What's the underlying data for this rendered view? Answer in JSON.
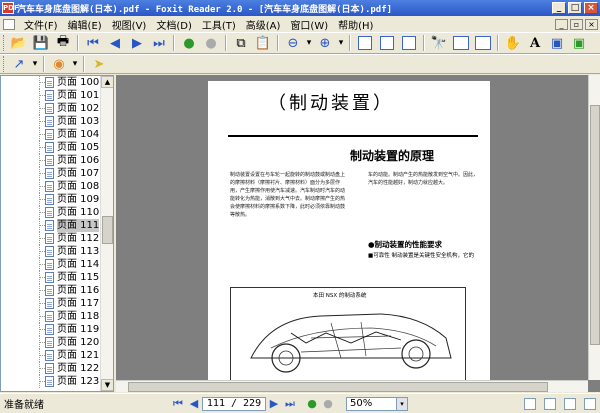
{
  "window": {
    "title": "汽车车身底盘图解(日本).pdf - Foxit Reader 2.0 - [汽车车身底盘图解(日本).pdf]",
    "app_icon_text": "PDF",
    "controls": {
      "minimize": "_",
      "maximize": "□",
      "close": "×"
    }
  },
  "menu": {
    "items": [
      "文件(F)",
      "编辑(E)",
      "视图(V)",
      "文档(D)",
      "工具(T)",
      "高级(A)",
      "窗口(W)",
      "帮助(H)"
    ],
    "mdi_controls": {
      "minimize": "_",
      "restore": "▫",
      "close": "×"
    }
  },
  "toolbar1": {
    "icons": [
      "open-icon",
      "save-icon",
      "print-icon",
      "first-page-icon",
      "previous-page-icon",
      "next-page-icon",
      "last-page-icon",
      "back-icon",
      "forward-icon",
      "copy-icon",
      "paste-icon",
      "zoom-out-icon",
      "zoom-in-icon",
      "actual-size-icon",
      "fit-page-icon",
      "fit-width-icon",
      "find-icon",
      "continuous-icon",
      "two-page-icon",
      "hand-tool-icon",
      "text-select-icon",
      "snapshot-icon",
      "image-tool-icon"
    ],
    "glyphs": {
      "open": "📂",
      "save": "💾",
      "print": "🖶",
      "first": "⏮",
      "prev": "◀",
      "next": "▶",
      "last": "⏭",
      "back": "●",
      "forward": "●",
      "copy": "⧉",
      "paste": "📋",
      "zoom_out": "⊖",
      "zoom_in": "⊕",
      "dropdown": "▾",
      "find": "🔭",
      "hand": "✋",
      "text": "A",
      "image": "▣"
    }
  },
  "toolbar2": {
    "glyphs": {
      "link": "↗",
      "dropdown": "▾",
      "annotation": "◉",
      "select": "➤"
    }
  },
  "sidebar": {
    "pages": [
      {
        "label": "页面 100"
      },
      {
        "label": "页面 101"
      },
      {
        "label": "页面 102"
      },
      {
        "label": "页面 103"
      },
      {
        "label": "页面 104"
      },
      {
        "label": "页面 105"
      },
      {
        "label": "页面 106"
      },
      {
        "label": "页面 107"
      },
      {
        "label": "页面 108"
      },
      {
        "label": "页面 109"
      },
      {
        "label": "页面 110"
      },
      {
        "label": "页面 111",
        "selected": true
      },
      {
        "label": "页面 112"
      },
      {
        "label": "页面 113"
      },
      {
        "label": "页面 114"
      },
      {
        "label": "页面 115"
      },
      {
        "label": "页面 116"
      },
      {
        "label": "页面 117"
      },
      {
        "label": "页面 118"
      },
      {
        "label": "页面 119"
      },
      {
        "label": "页面 120"
      },
      {
        "label": "页面 121"
      },
      {
        "label": "页面 122"
      },
      {
        "label": "页面 123"
      }
    ],
    "scroll_up": "▲",
    "scroll_down": "▼"
  },
  "document": {
    "title": "（制动装置）",
    "heading": "制动装置的原理",
    "col1_text": "制动装置设置在与车轮一起旋转的制动鼓或制动盘上的摩擦材料（摩擦衬片、摩擦材料）面分为多层作用，产生摩擦作用使汽车减速。汽车制动时汽车的动能转化为热能，消散到大气中去。制动摩擦产生的热会使摩擦材料的摩擦系数下降，此时必须依靠制动鼓等散热。",
    "col2_text": "车的动能。制动产生的热能散发到空气中。因此，汽车的性能越好，制动力就应越大。",
    "sub_heading": "●制动装置的性能要求",
    "sub_text": "■可靠性 制动装置是关键性安全机构，它的",
    "figure_caption": "本田 NSX 的制动系统"
  },
  "statusbar": {
    "status": "准备就绪",
    "page_display": "111 / 229",
    "zoom": "50%",
    "glyphs": {
      "first": "⏮",
      "prev": "◀",
      "next": "▶",
      "last": "⏭",
      "back": "●",
      "forward": "●",
      "dropdown": "▾"
    }
  },
  "colors": {
    "titlebar": "#2a57c8",
    "chrome": "#ece9d8",
    "viewer_bg": "#7f7f7f"
  }
}
